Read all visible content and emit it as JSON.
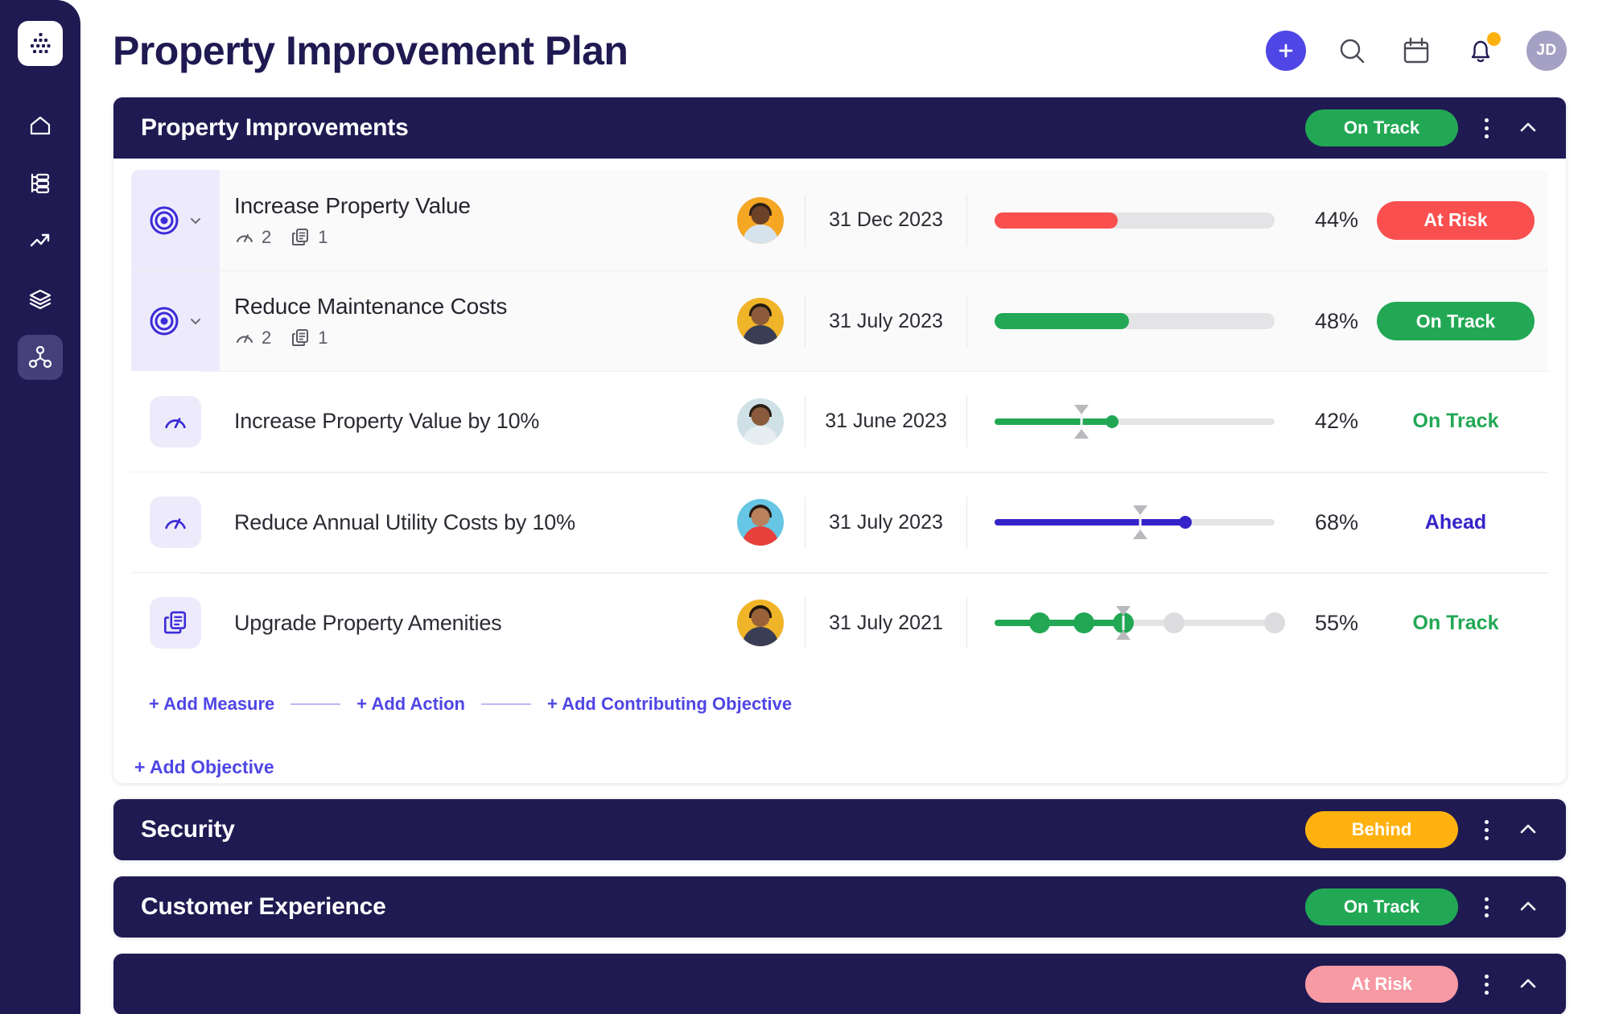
{
  "brand": {
    "primary": "#4F46E5",
    "navy": "#201A52",
    "green": "#22A854",
    "red": "#F9504F",
    "amber": "#FFB20F",
    "pink": "#F79AA3"
  },
  "sidebar": {
    "logo_icon": "grid-nodes-logo-icon",
    "items": [
      {
        "icon": "home-icon",
        "name": "home",
        "active": false
      },
      {
        "icon": "org-chart-icon",
        "name": "plans",
        "active": false
      },
      {
        "icon": "trending-up-icon",
        "name": "analytics",
        "active": false
      },
      {
        "icon": "layers-icon",
        "name": "layers",
        "active": false
      },
      {
        "icon": "share-nodes-icon",
        "name": "strategy-map",
        "active": true
      }
    ]
  },
  "header": {
    "title": "Property Improvement Plan",
    "actions": [
      {
        "icon": "plus-icon",
        "name": "add-button"
      },
      {
        "icon": "search-icon",
        "name": "search-button"
      },
      {
        "icon": "calendar-icon",
        "name": "calendar-button"
      },
      {
        "icon": "bell-icon",
        "name": "notifications-button",
        "has_badge": true
      },
      {
        "icon": "avatar",
        "name": "user-avatar",
        "initials": "JD"
      }
    ]
  },
  "sections": [
    {
      "title": "Property Improvements",
      "status": "On Track",
      "status_color": "#22A854",
      "expanded": true,
      "rows": [
        {
          "type": "objective",
          "icon": "target-icon",
          "title": "Increase Property Value",
          "measures_count": "2",
          "actions_count": "1",
          "owner_avatar": "owner-photo-1",
          "avatar_bg": "#F5A623",
          "avatar_skin": "#6B4228",
          "avatar_shirt": "#D7E3EC",
          "avatar_hair": "#2E2119",
          "date": "31 Dec 2023",
          "progress": 44,
          "bar_color": "#F9504F",
          "percent": "44%",
          "status": "At Risk",
          "status_style": "pill",
          "status_color": "#F9504F"
        },
        {
          "type": "objective",
          "icon": "target-icon",
          "title": "Reduce Maintenance Costs",
          "measures_count": "2",
          "actions_count": "1",
          "owner_avatar": "owner-photo-2",
          "avatar_bg": "#F0B429",
          "avatar_skin": "#8D5A3B",
          "avatar_shirt": "#3A3E55",
          "avatar_hair": "#271C12",
          "date": "31 July 2023",
          "progress": 48,
          "bar_color": "#22A854",
          "percent": "48%",
          "status": "On Track",
          "status_style": "pill",
          "status_color": "#22A854"
        },
        {
          "type": "measure",
          "icon": "gauge-icon",
          "title": "Increase Property Value by 10%",
          "owner_avatar": "owner-photo-3",
          "avatar_bg": "#CFE1E6",
          "avatar_skin": "#8A5A3C",
          "avatar_shirt": "#E6EEF2",
          "avatar_hair": "#2B1F18",
          "date": "31 June 2023",
          "progress": 42,
          "target_marker": 31,
          "bar_color": "#22A854",
          "percent": "42%",
          "status": "On Track",
          "status_style": "text",
          "status_color": "#22A854"
        },
        {
          "type": "measure",
          "icon": "gauge-icon",
          "title": "Reduce Annual Utility Costs by 10%",
          "owner_avatar": "owner-photo-4",
          "avatar_bg": "#67C6E3",
          "avatar_skin": "#B9825C",
          "avatar_shirt": "#E8413B",
          "avatar_hair": "#2A1C14",
          "date": "31 July 2023",
          "progress": 68,
          "target_marker": 52,
          "bar_color": "#3523C9",
          "percent": "68%",
          "status": "Ahead",
          "status_style": "text",
          "status_color": "#3523C9"
        },
        {
          "type": "action",
          "icon": "documents-icon",
          "title": "Upgrade Property Amenities",
          "owner_avatar": "owner-photo-5",
          "avatar_bg": "#F0B429",
          "avatar_skin": "#9A6239",
          "avatar_shirt": "#3A3E55",
          "avatar_hair": "#20160F",
          "date": "31 July 2021",
          "progress": 46,
          "target_marker": 46,
          "bar_color": "#22A854",
          "percent": "55%",
          "milestones": [
            16,
            32,
            46,
            64,
            100
          ],
          "milestones_done": 3,
          "status": "On Track",
          "status_style": "text",
          "status_color": "#22A854"
        }
      ],
      "add_links": [
        "+ Add Measure",
        "+ Add Action",
        "+ Add Contributing Objective"
      ],
      "add_objective": "+ Add Objective"
    },
    {
      "title": "Security",
      "status": "Behind",
      "status_color": "#FFB20F",
      "expanded": false
    },
    {
      "title": "Customer Experience",
      "status": "On Track",
      "status_color": "#22A854",
      "expanded": false
    },
    {
      "title": "",
      "status": "At Risk",
      "status_color": "#F79AA3",
      "expanded": false
    }
  ]
}
